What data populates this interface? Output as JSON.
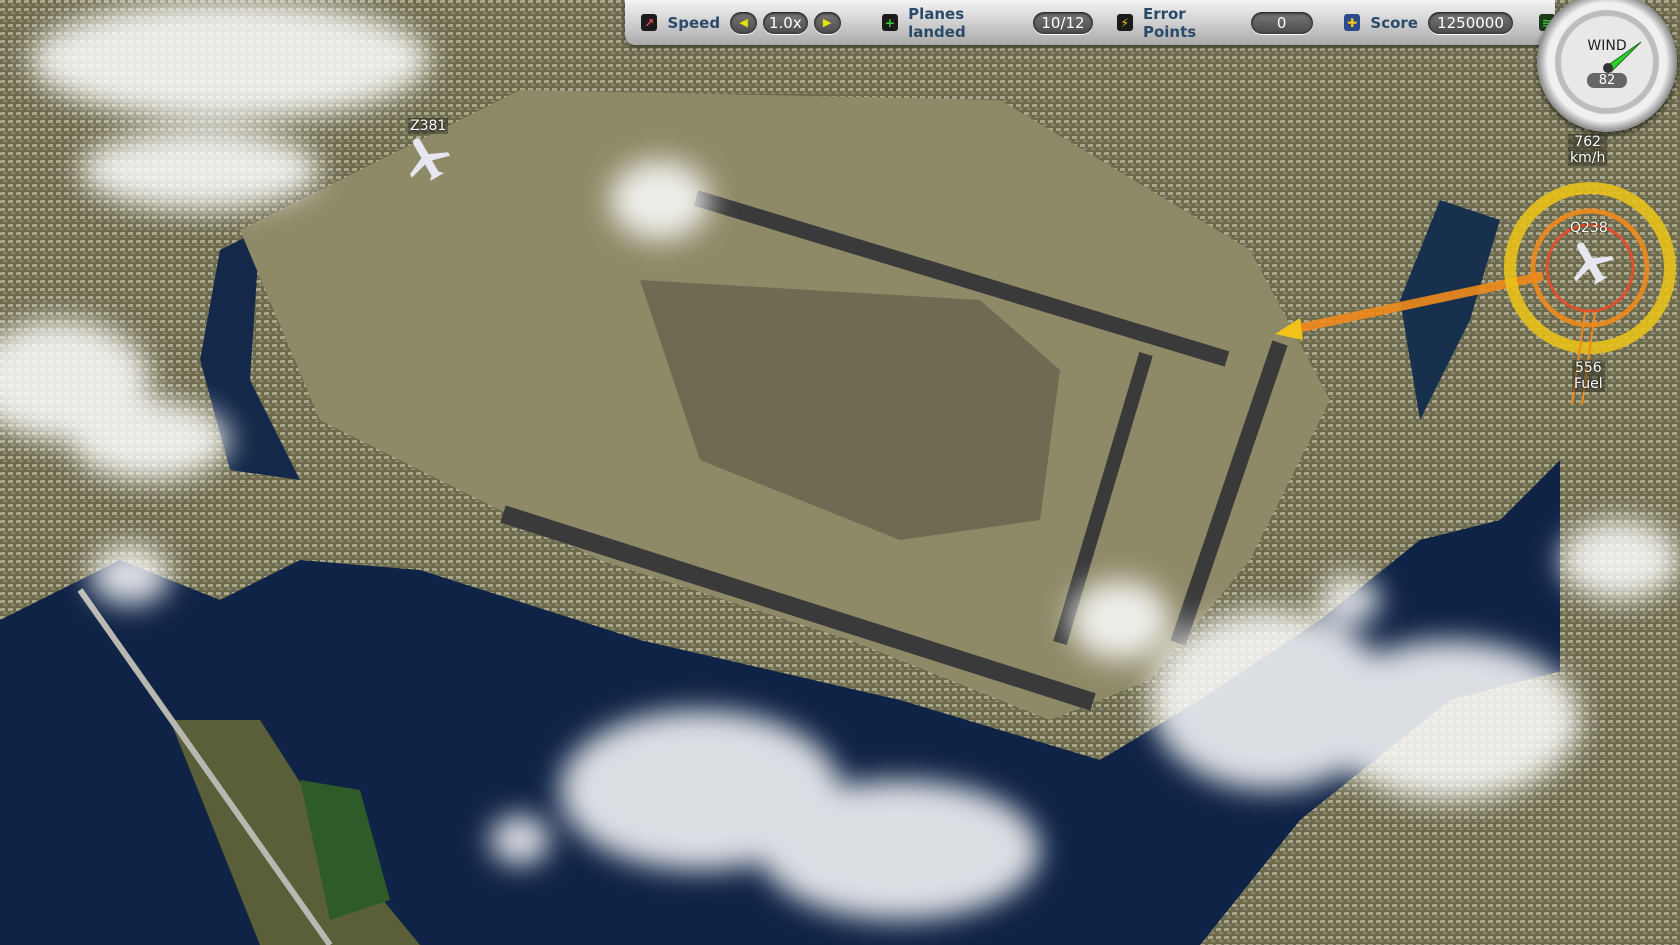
{
  "hud": {
    "speed_label": "Speed",
    "speed_value": "1.0x",
    "planes_landed_label": "Planes landed",
    "planes_landed_value": "10/12",
    "error_points_label": "Error Points",
    "error_points_value": "0",
    "score_label": "Score",
    "score_value": "1250000"
  },
  "wind": {
    "label": "WIND",
    "value": "82"
  },
  "aircraft": [
    {
      "callsign": "Z381"
    },
    {
      "callsign": "Q238",
      "speed": "762",
      "speed_unit": "km/h",
      "fuel": "556",
      "fuel_label": "Fuel"
    }
  ],
  "colors": {
    "accent_yellow": "#e8c21a",
    "accent_orange": "#f08a1c",
    "inner_red": "#e0502a"
  }
}
